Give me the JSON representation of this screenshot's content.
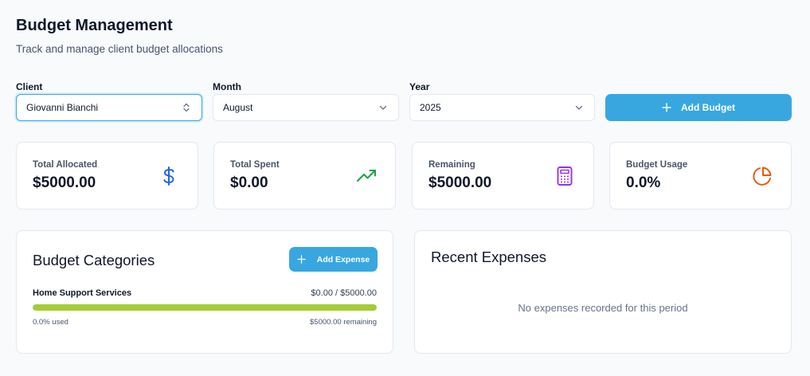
{
  "header": {
    "title": "Budget Management",
    "subtitle": "Track and manage client budget allocations"
  },
  "filters": {
    "client": {
      "label": "Client",
      "value": "Giovanni Bianchi"
    },
    "month": {
      "label": "Month",
      "value": "August"
    },
    "year": {
      "label": "Year",
      "value": "2025"
    }
  },
  "add_budget_label": "Add Budget",
  "stats": [
    {
      "label": "Total Allocated",
      "value": "$5000.00",
      "icon": "dollar-icon",
      "color": "#2563eb"
    },
    {
      "label": "Total Spent",
      "value": "$0.00",
      "icon": "trending-up-icon",
      "color": "#16a34a"
    },
    {
      "label": "Remaining",
      "value": "$5000.00",
      "icon": "calculator-icon",
      "color": "#9333ea"
    },
    {
      "label": "Budget Usage",
      "value": "0.0%",
      "icon": "pie-chart-icon",
      "color": "#ea580c"
    }
  ],
  "categories_panel": {
    "title": "Budget Categories",
    "add_expense_label": "Add Expense",
    "items": [
      {
        "name": "Home Support Services",
        "amount": "$0.00 / $5000.00",
        "used": "0.0% used",
        "remaining": "$5000.00 remaining",
        "bar_color": "#a3cc36",
        "fill_fraction": 1.0
      }
    ]
  },
  "expenses_panel": {
    "title": "Recent Expenses",
    "empty_message": "No expenses recorded for this period"
  },
  "colors": {
    "accent": "#38a7e0"
  }
}
